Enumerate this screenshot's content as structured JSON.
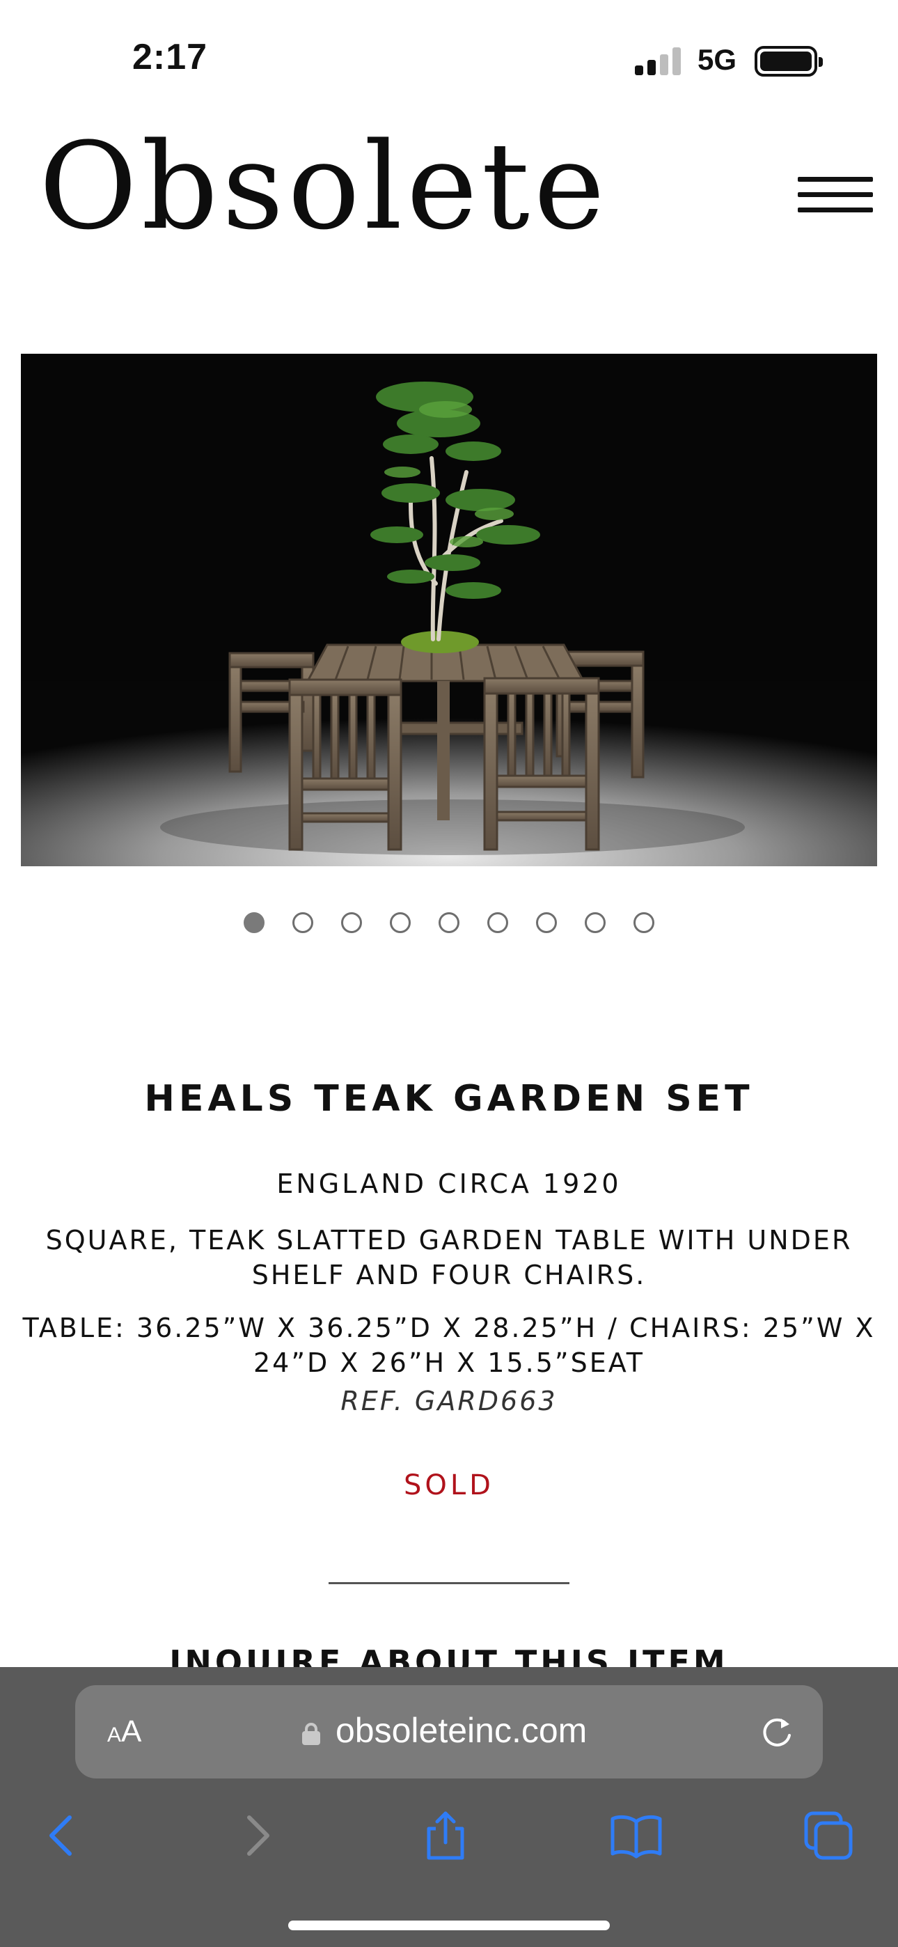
{
  "status_bar": {
    "time": "2:17",
    "network": "5G"
  },
  "header": {
    "logo": "Obsolete",
    "menu_icon": "hamburger-menu-icon"
  },
  "gallery": {
    "image_alt": "Teak garden table with four chairs and a bonsai tree",
    "total_slides": 9,
    "active_index": 0
  },
  "product": {
    "title": "HEALS TEAK GARDEN SET",
    "origin": "ENGLAND CIRCA 1920",
    "description": "SQUARE, TEAK SLATTED GARDEN TABLE WITH UNDER SHELF AND FOUR CHAIRS.",
    "dimensions": "TABLE: 36.25”W X 36.25”D X 28.25”H / CHAIRS: 25”W X 24”D X 26”H X 15.5”SEAT",
    "ref": "REF. GARD663",
    "status": "SOLD",
    "inquire": "INQUIRE ABOUT THIS ITEM"
  },
  "browser": {
    "text_size_label": "AA",
    "url": "obsoleteinc.com",
    "toolbar_icons": [
      "back-icon",
      "forward-icon",
      "share-icon",
      "bookmarks-icon",
      "tabs-icon"
    ]
  },
  "colors": {
    "sold": "#b0121b",
    "browser_chrome": "#5a5a5a",
    "toolbar_accent": "#2f7cf6"
  }
}
